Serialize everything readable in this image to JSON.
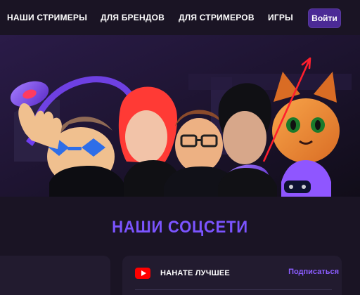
{
  "nav": {
    "items": [
      "НАШИ СТРИМЕРЫ",
      "ДЛЯ БРЕНДОВ",
      "ДЛЯ СТРИМЕРОВ",
      "ИГРЫ"
    ],
    "login_label": "Войти"
  },
  "section": {
    "title": "НАШИ СОЦСЕТИ"
  },
  "social": {
    "channel": "НАНАТЕ ЛУЧШЕЕ",
    "subscribe": "Подписаться"
  },
  "colors": {
    "background": "#1a1424",
    "accent": "#7b54ff",
    "button": "#4b2a96",
    "card": "#221b2f",
    "youtube": "#ff0000",
    "arrow": "#ff1f2d"
  },
  "icons": {
    "youtube": "youtube-icon"
  }
}
